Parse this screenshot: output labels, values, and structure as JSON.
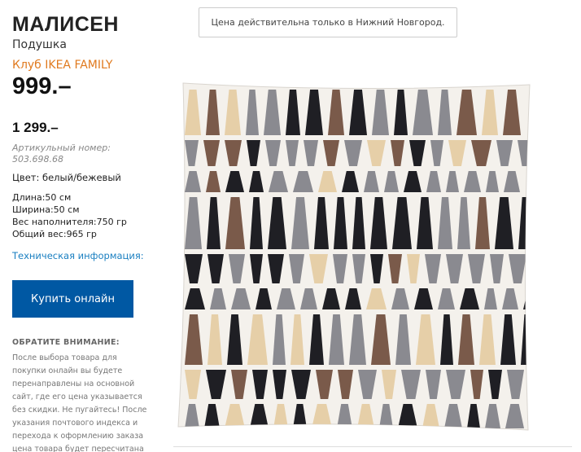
{
  "product": {
    "title": "МАЛИСЕН",
    "subtitle": "Подушка",
    "family_label": "Клуб IKEA FAMILY",
    "price": "999.–",
    "old_price": "1 299.–",
    "article": "Артикульный номер: 503.698.68",
    "color": "Цвет: белый/бежевый",
    "specs": [
      "Длина:50 см",
      "Ширина:50 см",
      "Вес наполнителя:750 гр",
      "Общий вес:965 гр"
    ],
    "tech_link": "Техническая информация:",
    "buy_label": "Купить онлайн"
  },
  "notice_text": "Цена действительна только в Нижний Новгород.",
  "attention": {
    "heading": "ОБРАТИТЕ ВНИМАНИЕ:",
    "text": "После выбора товара для покупки онлайн вы будете перенаправлены на основной сайт, где его цена указывается без скидки. Не пугайтесь! После указания почтового индекса и перехода к оформлению заказа цена товара будет пересчитана с учетом"
  },
  "colors": {
    "family": "#e07a1f",
    "link": "#1a7fc1",
    "buy_button": "#0058a3",
    "pattern_dark": "#1f1f24",
    "pattern_brown": "#7a5a4a",
    "pattern_grey": "#8a8a90",
    "pattern_beige": "#e6cfa8"
  },
  "icons": {
    "product_image": "cushion-pattern-image"
  }
}
